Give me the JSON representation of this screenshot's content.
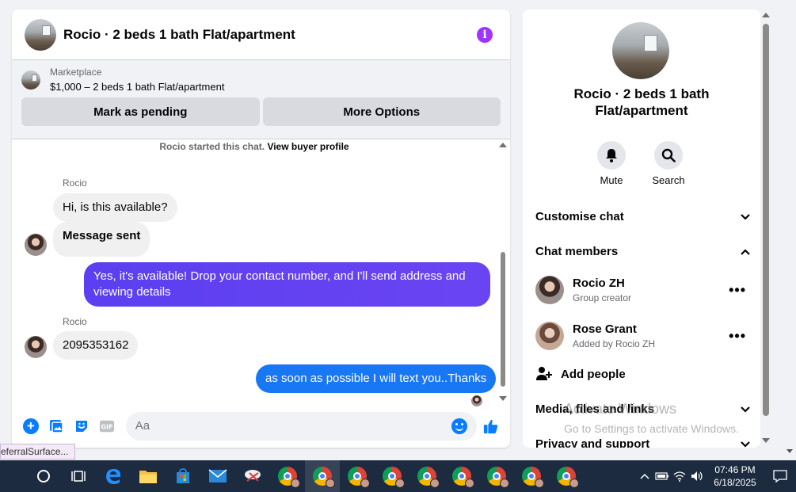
{
  "chat": {
    "title": "Rocio · 2 beds 1 bath Flat/apartment",
    "marketplace": {
      "label": "Marketplace",
      "listing": "$1,000 – 2 beds 1 bath Flat/apartment",
      "mark_pending": "Mark as pending",
      "more_options": "More Options"
    },
    "started_prefix": "Rocio started this chat.",
    "view_profile": "View buyer profile",
    "messages": [
      {
        "sender": "Rocio",
        "text": "Hi, is this available?"
      },
      {
        "text": "Message sent"
      },
      {
        "text": "Yes, it's available! Drop your contact number, and I'll send address and viewing details"
      },
      {
        "sender": "Rocio",
        "text": "2095353162"
      },
      {
        "text": "as soon as possible I will text you..Thanks"
      }
    ],
    "composer_placeholder": "Aa"
  },
  "side": {
    "title": "Rocio · 2 beds 1 bath Flat/apartment",
    "actions": {
      "mute": "Mute",
      "search": "Search"
    },
    "customise": "Customise chat",
    "members_heading": "Chat members",
    "members": [
      {
        "name": "Rocio ZH",
        "role": "Group creator"
      },
      {
        "name": "Rose Grant",
        "role": "Added by Rocio ZH"
      }
    ],
    "add_people": "Add people",
    "media": "Media, files and links",
    "privacy": "Privacy and support"
  },
  "watermark": {
    "line1": "Activate Windows",
    "line2": "Go to Settings to activate Windows."
  },
  "tooltip": "eferralSurface...",
  "taskbar": {
    "time": "07:46 PM",
    "date": "6/18/2025"
  },
  "colors": {
    "accent": "#1877f2",
    "outgoing": "#6a44f2",
    "info": "#a033ff",
    "taskbar": "#1c2b40"
  }
}
